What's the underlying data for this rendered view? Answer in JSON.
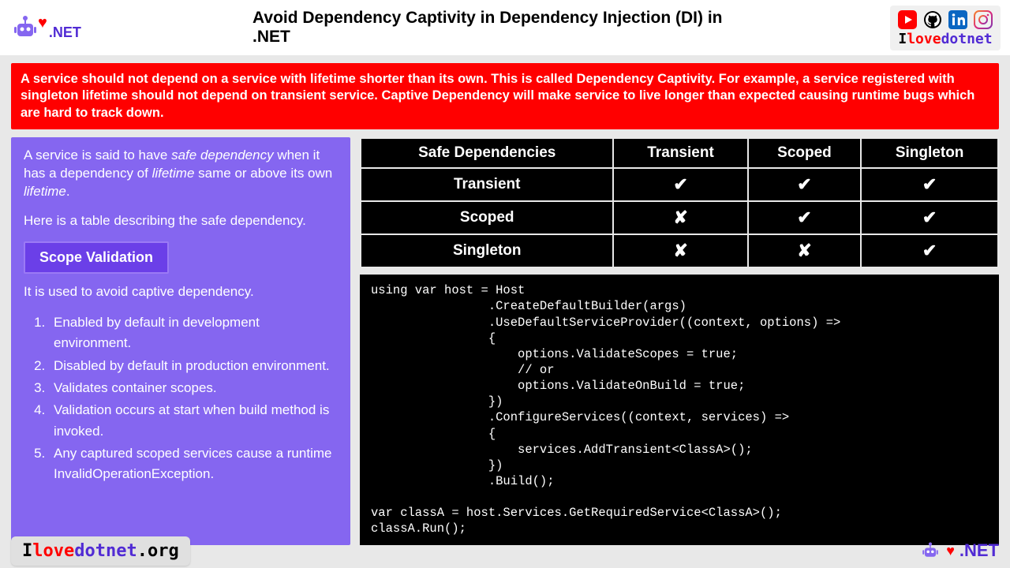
{
  "header": {
    "logo_text": ".NET",
    "title": "Avoid Dependency Captivity in Dependency Injection (DI) in .NET",
    "brand": {
      "i": "I",
      "love": "love",
      "dotnet": "dotnet"
    }
  },
  "banner": "A service should not depend on a service with lifetime shorter than its own. This is called Dependency Captivity. For example, a service registered with singleton lifetime should not depend on transient service. Captive Dependency will make service to live longer than expected causing runtime bugs which are hard to track down.",
  "left": {
    "para1_a": "A service is said to have ",
    "para1_b": "safe dependency",
    "para1_c": " when it has a dependency of ",
    "para1_d": "lifetime",
    "para1_e": " same or above its own ",
    "para1_f": "lifetime",
    "para1_g": ".",
    "para2": "Here is a table describing the safe dependency.",
    "scope_title": "Scope Validation",
    "scope_desc": "It is used to avoid captive dependency.",
    "items": [
      "Enabled by default in development environment.",
      "Disabled by default in production environment.",
      "Validates container scopes.",
      "Validation occurs at start when build method is invoked.",
      "Any captured scoped services cause a runtime InvalidOperationException."
    ]
  },
  "table": {
    "h0": "Safe Dependencies",
    "h1": "Transient",
    "h2": "Scoped",
    "h3": "Singleton",
    "rows": [
      {
        "label": "Transient",
        "c1": "✔",
        "c2": "✔",
        "c3": "✔",
        "s1": "check",
        "s2": "check",
        "s3": "check"
      },
      {
        "label": "Scoped",
        "c1": "✘",
        "c2": "✔",
        "c3": "✔",
        "s1": "cross",
        "s2": "check",
        "s3": "check"
      },
      {
        "label": "Singleton",
        "c1": "✘",
        "c2": "✘",
        "c3": "✔",
        "s1": "cross",
        "s2": "cross",
        "s3": "check"
      }
    ]
  },
  "code": "using var host = Host\n                .CreateDefaultBuilder(args)\n                .UseDefaultServiceProvider((context, options) =>\n                {\n                    options.ValidateScopes = true;\n                    // or\n                    options.ValidateOnBuild = true;\n                })\n                .ConfigureServices((context, services) =>\n                {\n                    services.AddTransient<ClassA>();\n                })\n                .Build();\n\nvar classA = host.Services.GetRequiredService<ClassA>();\nclassA.Run();",
  "footer": {
    "i": "I",
    "love": "love",
    "dotnet": "dotnet",
    "org": ".org",
    "right_dotnet": ".NET"
  }
}
